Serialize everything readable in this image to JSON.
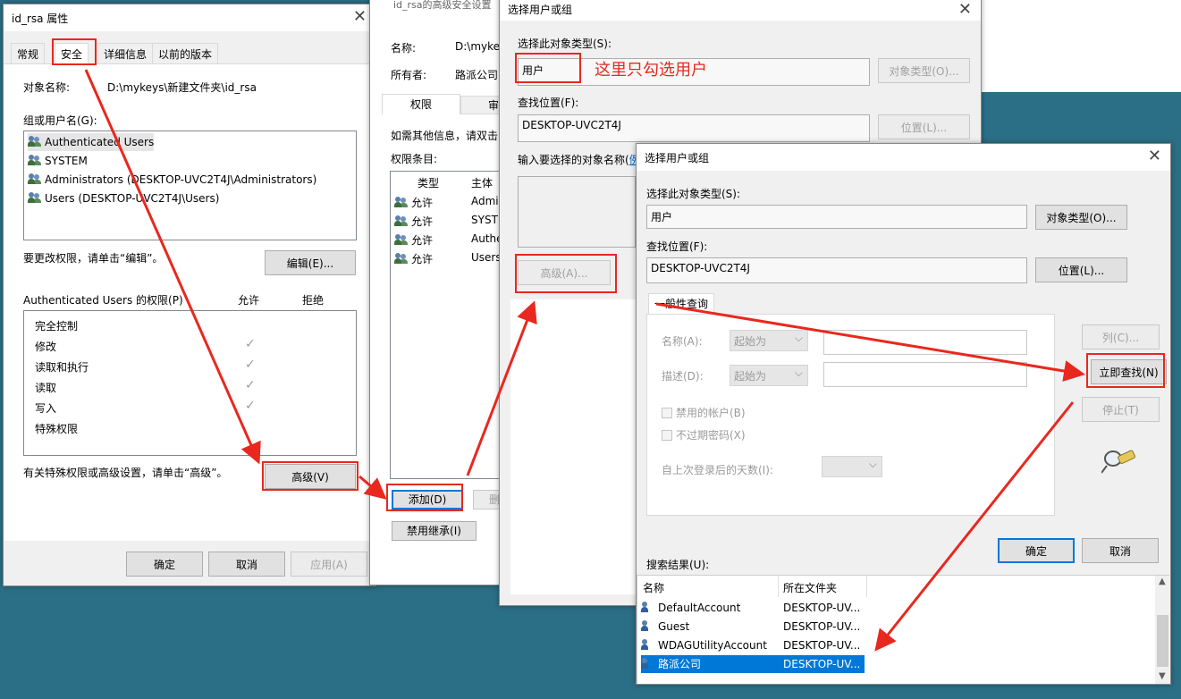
{
  "prop": {
    "title": "id_rsa 属性",
    "tabs": [
      "常规",
      "安全",
      "详细信息",
      "以前的版本"
    ],
    "object_label": "对象名称:",
    "object_value": "D:\\mykeys\\新建文件夹\\id_rsa",
    "group_label": "组或用户名(G):",
    "users": [
      "Authenticated Users",
      "SYSTEM",
      "Administrators (DESKTOP-UVC2T4J\\Administrators)",
      "Users (DESKTOP-UVC2T4J\\Users)"
    ],
    "change_hint": "要更改权限，请单击“编辑”。",
    "edit_btn": "编辑(E)...",
    "perm_title": "Authenticated Users 的权限(P)",
    "allow": "允许",
    "deny": "拒绝",
    "perms": [
      "完全控制",
      "修改",
      "读取和执行",
      "读取",
      "写入",
      "特殊权限"
    ],
    "checks": [
      "✓",
      "✓",
      "✓",
      "✓"
    ],
    "adv_hint": "有关特殊权限或高级设置，请单击“高级”。",
    "adv_btn": "高级(V)",
    "ok": "确定",
    "cancel": "取消",
    "apply": "应用(A)"
  },
  "adv": {
    "title": "id_rsa的高级安全设置",
    "name_label": "名称:",
    "name_value": "D:\\mykeys",
    "owner_label": "所有者:",
    "owner_value": "路派公司",
    "tab1": "权限",
    "tab2": "审",
    "info": "如需其他信息，请双击",
    "entries_label": "权限条目:",
    "col_type": "类型",
    "col_principal": "主体",
    "entries": [
      {
        "type": "允许",
        "principal": "Admin"
      },
      {
        "type": "允许",
        "principal": "SYSTE"
      },
      {
        "type": "允许",
        "principal": "Authe"
      },
      {
        "type": "允许",
        "principal": "Users"
      }
    ],
    "add_btn": "添加(D)",
    "remove_btn": "删除",
    "disable_inherit": "禁用继承(I)"
  },
  "sel1": {
    "title": "选择用户或组",
    "type_label": "选择此对象类型(S):",
    "type_value": "用户",
    "annotation": "这里只勾选用户",
    "type_btn": "对象类型(O)...",
    "loc_label": "查找位置(F):",
    "loc_value": "DESKTOP-UVC2T4J",
    "loc_btn": "位置(L)...",
    "enter_label": "输入要选择的对象名称(",
    "enter_link": "例",
    "adv_btn": "高级(A)..."
  },
  "sel2": {
    "title": "选择用户或组",
    "type_label": "选择此对象类型(S):",
    "type_value": "用户",
    "type_btn": "对象类型(O)...",
    "loc_label": "查找位置(F):",
    "loc_value": "DESKTOP-UVC2T4J",
    "loc_btn": "位置(L)...",
    "query_tab": "一般性查询",
    "name_label": "名称(A):",
    "desc_label": "描述(D):",
    "starts_with": "起始为",
    "disabled_accounts": "禁用的帐户(B)",
    "no_expire": "不过期密码(X)",
    "days_label": "自上次登录后的天数(I):",
    "col_btn": "列(C)...",
    "find_btn": "立即查找(N)",
    "stop_btn": "停止(T)",
    "ok": "确定",
    "cancel": "取消",
    "results_label": "搜索结果(U):",
    "col_name": "名称",
    "col_folder": "所在文件夹",
    "results": [
      {
        "name": "DefaultAccount",
        "folder": "DESKTOP-UV..."
      },
      {
        "name": "Guest",
        "folder": "DESKTOP-UV..."
      },
      {
        "name": "WDAGUtilityAccount",
        "folder": "DESKTOP-UV..."
      },
      {
        "name": "路派公司",
        "folder": "DESKTOP-UV..."
      }
    ]
  },
  "colors": {
    "annotation": "#e8281f",
    "selection": "#0078d7",
    "desktop": "#2b6f86"
  }
}
